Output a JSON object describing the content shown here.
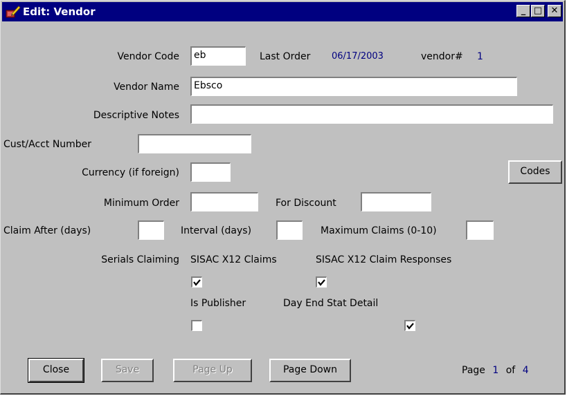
{
  "window": {
    "title": "Edit: Vendor",
    "minimize": "_",
    "maximize": "□",
    "close": "✕",
    "icon": "book-edit-icon"
  },
  "form": {
    "vendor_code": {
      "label": "Vendor Code",
      "value": "eb"
    },
    "last_order": {
      "label": "Last Order",
      "value": "06/17/2003"
    },
    "vendor_num": {
      "label": "vendor#",
      "value": "1"
    },
    "vendor_name": {
      "label": "Vendor Name",
      "value": "Ebsco"
    },
    "descriptive_notes": {
      "label": "Descriptive Notes",
      "value": ""
    },
    "cust_acct_number": {
      "label": "Cust/Acct Number",
      "value": ""
    },
    "currency": {
      "label": "Currency (if foreign)",
      "value": ""
    },
    "minimum_order": {
      "label": "Minimum Order",
      "value": ""
    },
    "for_discount": {
      "label": "For Discount",
      "value": ""
    },
    "claim_after": {
      "label": "Claim After (days)",
      "value": ""
    },
    "interval": {
      "label": "Interval (days)",
      "value": ""
    },
    "maximum_claims": {
      "label": "Maximum Claims (0-10)",
      "value": ""
    },
    "serials_claiming_label": "Serials Claiming",
    "sisac_x12_claims": {
      "label": "SISAC X12 Claims",
      "checked": true
    },
    "sisac_x12_claim_responses": {
      "label": "SISAC X12 Claim Responses",
      "checked": true
    },
    "is_publisher": {
      "label": "Is Publisher",
      "checked": false
    },
    "day_end_stat_detail": {
      "label": "Day End Stat Detail",
      "checked": true
    }
  },
  "buttons": {
    "codes": "Codes",
    "close": "Close",
    "save": "Save",
    "page_up": "Page Up",
    "page_down": "Page Down"
  },
  "paging": {
    "page_label": "Page",
    "current": "1",
    "of_label": "of",
    "total": "4"
  },
  "colors": {
    "titlebar": "#000080",
    "window_bg": "#c0c0c0",
    "value_text": "#000080"
  }
}
